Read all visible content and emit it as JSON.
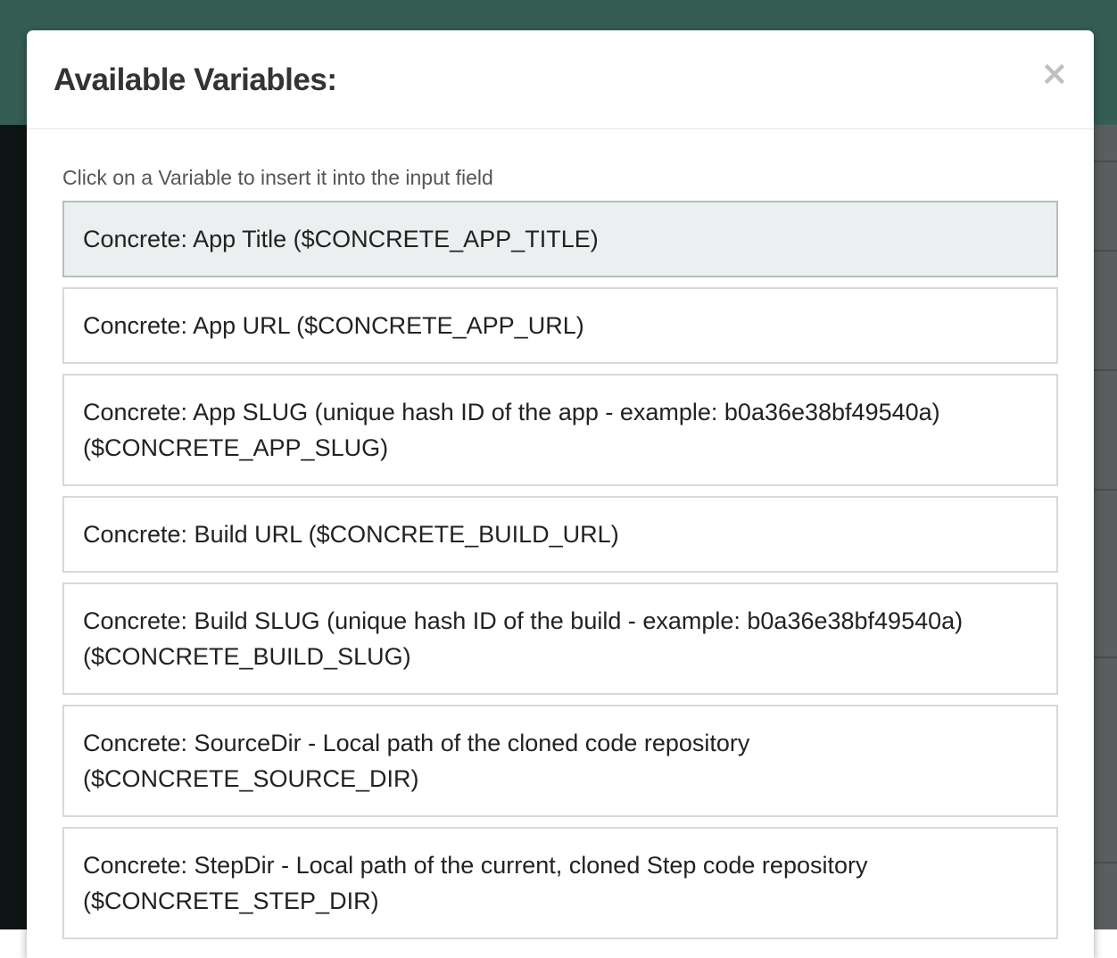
{
  "modal": {
    "title": "Available Variables:",
    "close_label": "×",
    "instructions": "Click on a Variable to insert it into the input field"
  },
  "variables": [
    {
      "text": "Concrete: App Title ($CONCRETE_APP_TITLE)",
      "highlighted": true
    },
    {
      "text": "Concrete: App URL ($CONCRETE_APP_URL)",
      "highlighted": false
    },
    {
      "text": "Concrete: App SLUG (unique hash ID of the app - example: b0a36e38bf49540a) ($CONCRETE_APP_SLUG)",
      "highlighted": false
    },
    {
      "text": "Concrete: Build URL ($CONCRETE_BUILD_URL)",
      "highlighted": false
    },
    {
      "text": "Concrete: Build SLUG (unique hash ID of the build - example: b0a36e38bf49540a) ($CONCRETE_BUILD_SLUG)",
      "highlighted": false
    },
    {
      "text": "Concrete: SourceDir - Local path of the cloned code repository ($CONCRETE_SOURCE_DIR)",
      "highlighted": false
    },
    {
      "text": "Concrete: StepDir - Local path of the current, cloned Step code repository ($CONCRETE_STEP_DIR)",
      "highlighted": false
    }
  ],
  "colors": {
    "header_bar": "#355d53",
    "highlight_bg": "#ebeff0",
    "item_border": "#d8d8d8"
  }
}
